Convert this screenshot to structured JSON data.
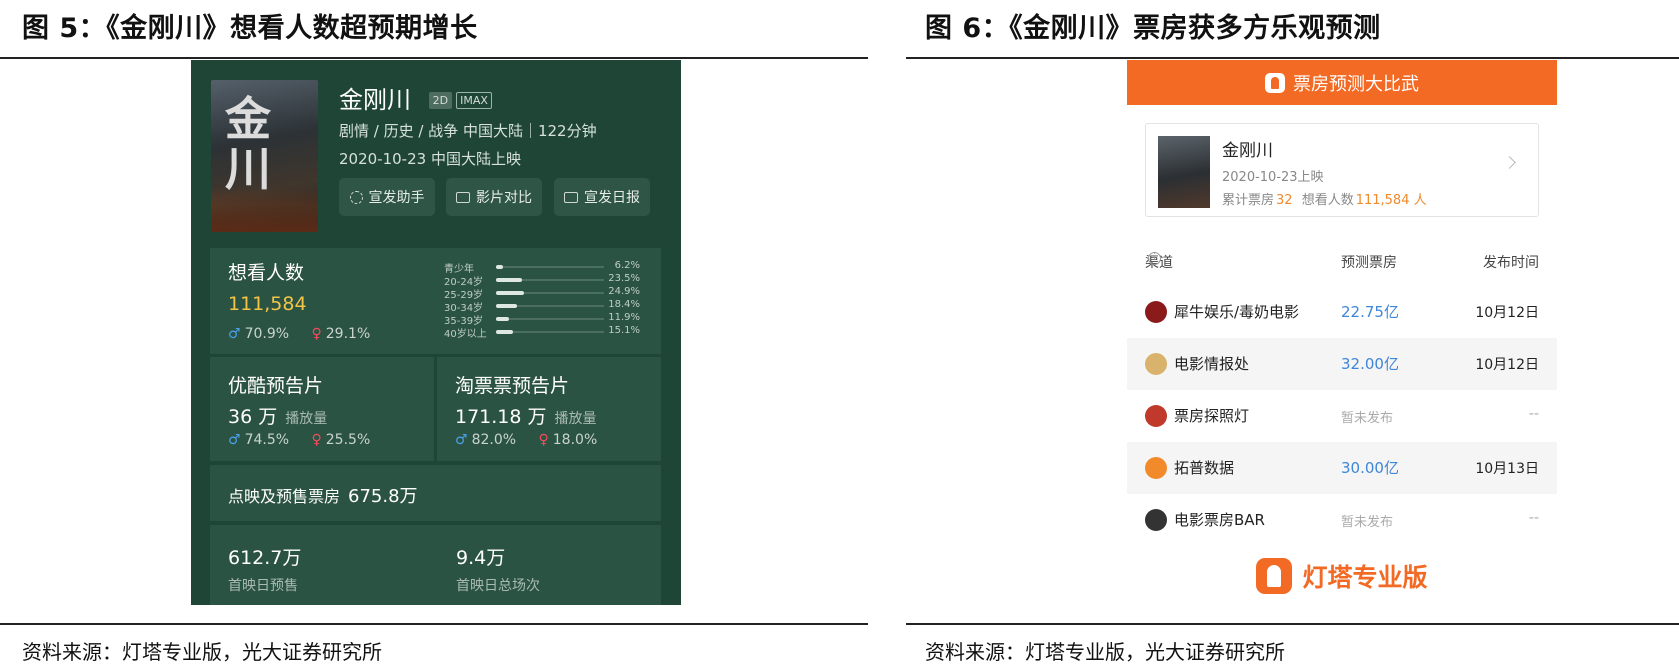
{
  "fig5": {
    "title": "图 5：《金刚川》想看人数超预期增长",
    "source": "资料来源：灯塔专业版，光大证券研究所",
    "movie": {
      "title": "金刚川",
      "tag_2d": "2D",
      "tag_imax": "IMAX",
      "genre_line": "剧情 / 历史 / 战争 中国大陆｜122分钟",
      "release_line": "2020-10-23 中国大陆上映",
      "buttons": [
        "宣发助手",
        "影片对比",
        "宣发日报"
      ]
    },
    "want": {
      "label": "想看人数",
      "value": "111,584",
      "male_pct": "70.9%",
      "female_pct": "29.1%",
      "male_symbol": "♂",
      "female_symbol": "♀",
      "ages": [
        {
          "label": "青少年",
          "pct": "6.2%",
          "value": 6.2
        },
        {
          "label": "20-24岁",
          "pct": "23.5%",
          "value": 23.5
        },
        {
          "label": "25-29岁",
          "pct": "24.9%",
          "value": 24.9
        },
        {
          "label": "30-34岁",
          "pct": "18.4%",
          "value": 18.4
        },
        {
          "label": "35-39岁",
          "pct": "11.9%",
          "value": 11.9
        },
        {
          "label": "40岁以上",
          "pct": "15.1%",
          "value": 15.1
        }
      ]
    },
    "youku": {
      "label": "优酷预告片",
      "value": "36 万",
      "unit": "播放量",
      "male_pct": "74.5%",
      "female_pct": "25.5%"
    },
    "taopiaopiao": {
      "label": "淘票票预告片",
      "value": "171.18 万",
      "unit": "播放量",
      "male_pct": "82.0%",
      "female_pct": "18.0%"
    },
    "box": {
      "label": "点映及预售票房",
      "value": "675.8万"
    },
    "presale": {
      "value": "612.7万",
      "label": "首映日预售"
    },
    "shows": {
      "value": "9.4万",
      "label": "首映日总场次"
    }
  },
  "fig6": {
    "title": "图 6：《金刚川》票房获多方乐观预测",
    "source": "资料来源：灯塔专业版，光大证券研究所",
    "banner": "票房预测大比武",
    "card": {
      "title": "金刚川",
      "date": "2020-10-23上映",
      "box_label": "累计票房",
      "box_value": "32",
      "want_label": "想看人数",
      "want_value": "111,584 人"
    },
    "headers": {
      "channel": "渠道",
      "info": "i",
      "forecast": "预测票房",
      "date": "发布时间"
    },
    "rows": [
      {
        "name": "犀牛娱乐/毒奶电影",
        "forecast": "22.75亿",
        "date": "10月12日",
        "logo_color": "#8b1a1a"
      },
      {
        "name": "电影情报处",
        "forecast": "32.00亿",
        "date": "10月12日",
        "logo_color": "#d9b36b"
      },
      {
        "name": "票房探照灯",
        "forecast": "暂未发布",
        "date": "--",
        "logo_color": "#c0392b"
      },
      {
        "name": "拓普数据",
        "forecast": "30.00亿",
        "date": "10月13日",
        "logo_color": "#f28a2c"
      },
      {
        "name": "电影票房BAR",
        "forecast": "暂未发布",
        "date": "--",
        "logo_color": "#333333"
      }
    ],
    "logo_text": "灯塔专业版"
  }
}
